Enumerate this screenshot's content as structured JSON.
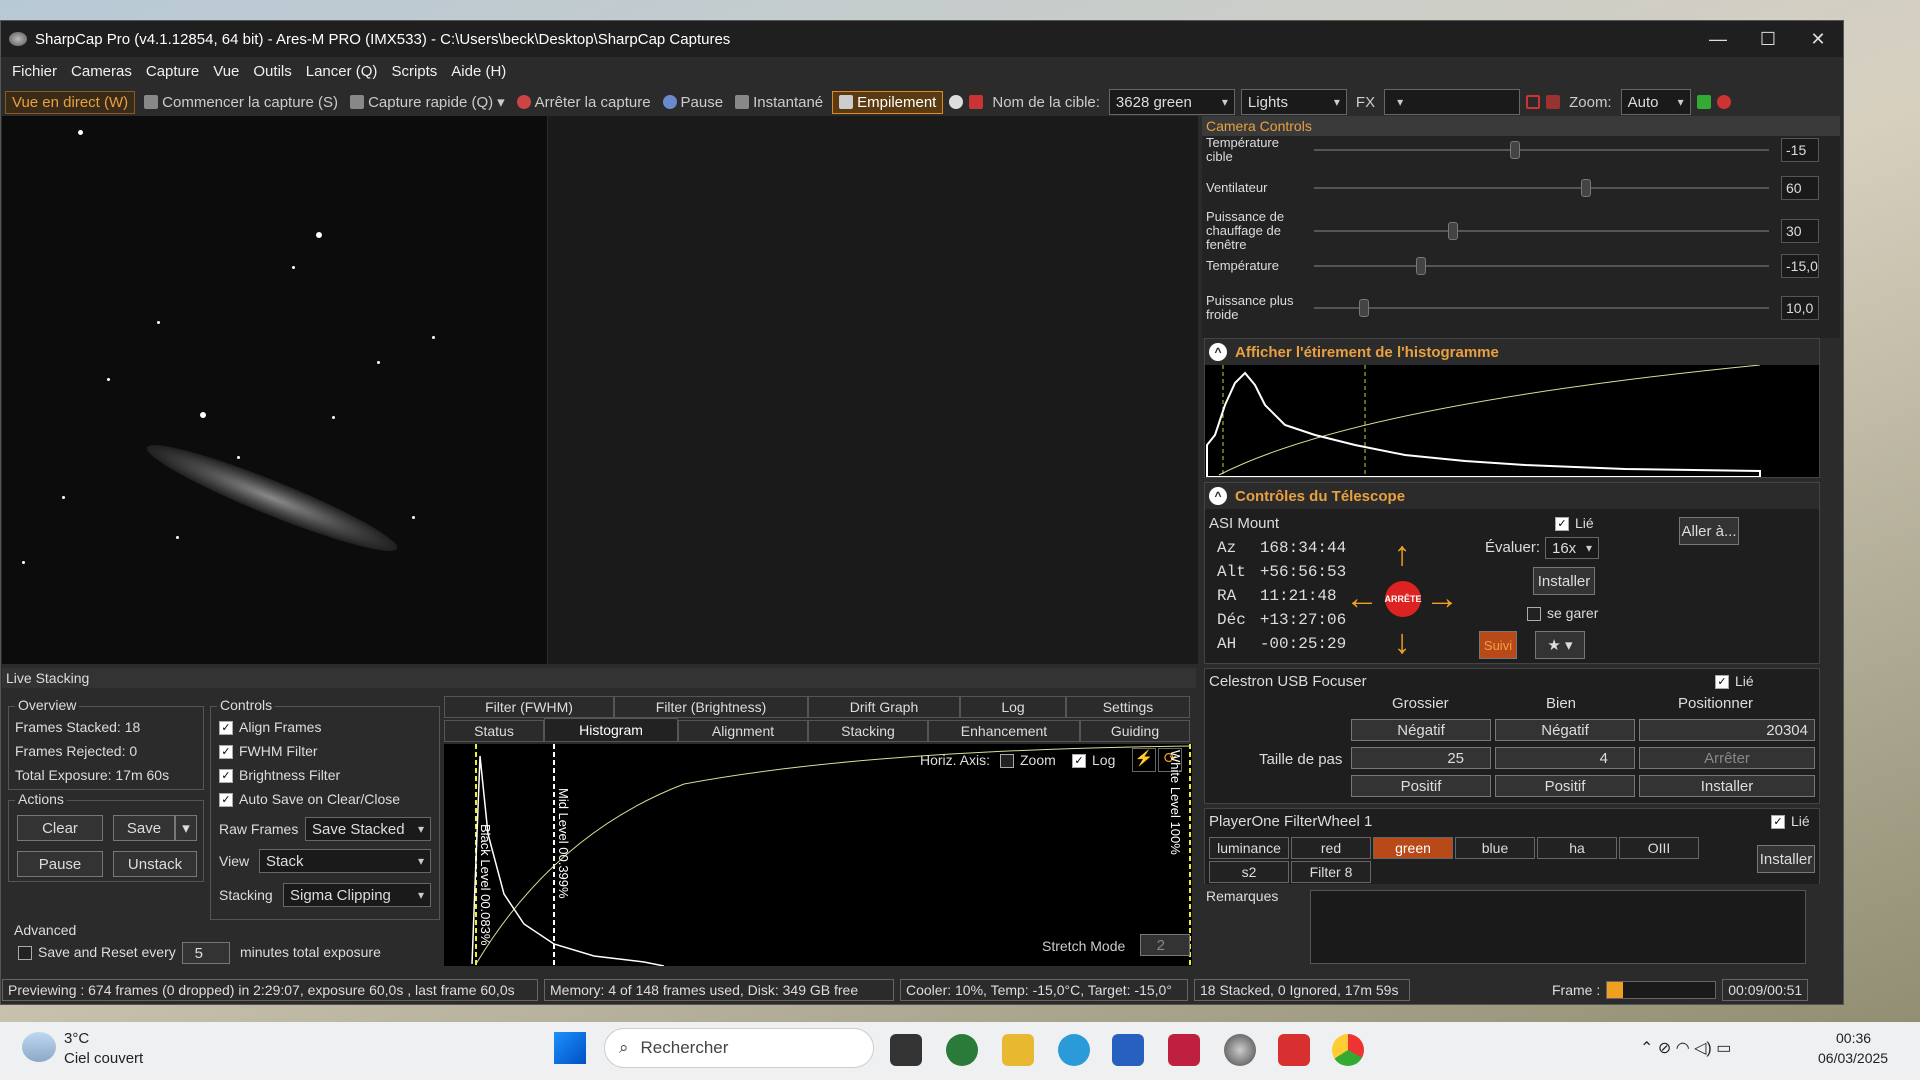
{
  "window": {
    "title": "SharpCap Pro (v4.1.12854, 64 bit) - Ares-M PRO (IMX533) - C:\\Users\\beck\\Desktop\\SharpCap Captures"
  },
  "menu": [
    "Fichier",
    "Cameras",
    "Capture",
    "Vue",
    "Outils",
    "Lancer (Q)",
    "Scripts",
    "Aide (H)"
  ],
  "toolbar": {
    "live": "Vue en direct (W)",
    "start_capture": "Commencer la capture (S)",
    "quick_capture": "Capture rapide (Q)",
    "stop_capture": "Arrêter la capture",
    "pause": "Pause",
    "snapshot": "Instantané",
    "stacking": "Empilement",
    "target_label": "Nom de la cible:",
    "target_value": "3628 green",
    "frame_type": "Lights",
    "fx_label": "FX",
    "zoom_label": "Zoom:",
    "zoom_value": "Auto"
  },
  "camera_controls": {
    "title": "Camera Controls",
    "sliders": [
      {
        "label": "Température cible",
        "value": "-15",
        "level": 0.44
      },
      {
        "label": "Ventilateur",
        "value": "60",
        "level": 0.6
      },
      {
        "label": "Puissance de chauffage de fenêtre",
        "value": "30",
        "level": 0.3
      },
      {
        "label": "Température",
        "value": "-15,0",
        "level": 0.23
      },
      {
        "label": "Puissance plus froide",
        "value": "10,0",
        "level": 0.1
      }
    ]
  },
  "histogram_panel": {
    "title": "Afficher l'étirement de l'histogramme"
  },
  "telescope": {
    "title": "Contrôles du Télescope",
    "mount": "ASI Mount",
    "linked": "Lié",
    "coords": [
      {
        "k": "Az",
        "v": "168:34:44"
      },
      {
        "k": "Alt",
        "v": "+56:56:53"
      },
      {
        "k": "RA",
        "v": "11:21:48"
      },
      {
        "k": "Déc",
        "v": "+13:27:06"
      },
      {
        "k": "AH",
        "v": "-00:25:29"
      }
    ],
    "rate_label": "Évaluer:",
    "rate_value": "16x",
    "goto": "Aller à...",
    "install": "Installer",
    "stop": "ARRÊTE",
    "park": "se garer",
    "track": "Suivi"
  },
  "focuser": {
    "title": "Celestron USB Focuser",
    "linked": "Lié",
    "col_coarse": "Grossier",
    "col_fine": "Bien",
    "col_pos": "Positionner",
    "neg": "Négatif",
    "pos": "Positif",
    "position": "20304",
    "step_label": "Taille de pas",
    "coarse_step": "25",
    "fine_step": "4",
    "stop": "Arrêter",
    "install": "Installer"
  },
  "filterwheel": {
    "title": "PlayerOne FilterWheel 1",
    "linked": "Lié",
    "filters": [
      "luminance",
      "red",
      "green",
      "blue",
      "ha",
      "OIII",
      "s2",
      "Filter 8"
    ],
    "selected": "green",
    "install": "Installer"
  },
  "remarks": {
    "label": "Remarques"
  },
  "live_stacking": {
    "title": "Live Stacking",
    "overview_title": "Overview",
    "frames_stacked": "Frames Stacked:  18",
    "frames_rejected": "Frames Rejected: 0",
    "total_exposure": "Total Exposure:   17m 60s",
    "actions_title": "Actions",
    "clear": "Clear",
    "save": "Save",
    "pause": "Pause",
    "unstack": "Unstack",
    "advanced_title": "Advanced",
    "save_reset": "Save and Reset every",
    "save_reset_value": "5",
    "save_reset_suffix": "minutes total exposure",
    "controls_title": "Controls",
    "align": "Align Frames",
    "fwhm": "FWHM Filter",
    "brightness": "Brightness Filter",
    "autosave": "Auto Save on Clear/Close",
    "raw_label": "Raw Frames",
    "raw_value": "Save Stacked",
    "view_label": "View",
    "view_value": "Stack",
    "stacking_label": "Stacking",
    "stacking_value": "Sigma Clipping",
    "tabs_top": [
      "Filter (FWHM)",
      "Filter (Brightness)",
      "Drift Graph",
      "Log",
      "Settings"
    ],
    "tabs_bottom": [
      "Status",
      "Histogram",
      "Alignment",
      "Stacking",
      "Enhancement",
      "Guiding"
    ],
    "horiz_axis": "Horiz. Axis:",
    "zoom": "Zoom",
    "log": "Log",
    "black_level": "Black Level 00.083%",
    "mid_level": "Mid Level 00.399%",
    "white_level": "White Level 100%",
    "stretch_mode": "Stretch Mode",
    "stretch_value": "2"
  },
  "status": {
    "previewing": "Previewing : 674 frames (0 dropped) in 2:29:07, exposure 60,0s , last frame 60,0s",
    "memory": "Memory: 4 of 148 frames used, Disk: 349 GB free",
    "cooler": "Cooler: 10%, Temp: -15,0°C, Target: -15,0°",
    "stacked": "18 Stacked, 0 Ignored, 17m 59s",
    "frame_label": "Frame :",
    "time": "00:09/00:51"
  },
  "taskbar": {
    "temp": "3°C",
    "weather": "Ciel couvert",
    "search": "Rechercher",
    "clock": "00:36",
    "date": "06/03/2025"
  },
  "colors": {
    "accent": "#e8a040",
    "filter_selected": "#b84a1a"
  }
}
